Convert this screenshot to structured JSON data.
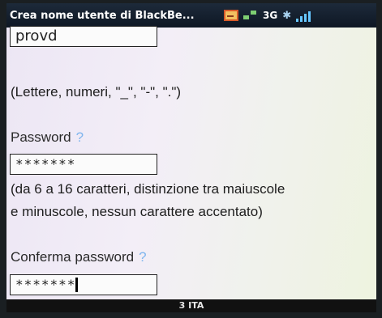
{
  "window": {
    "title": "Crea nome utente di BlackBe..."
  },
  "status_icons": {
    "network": "3G"
  },
  "form": {
    "username_value": "provd",
    "username_hint": "(Lettere, numeri, \"_\", \"-\", \".\")",
    "password_label": "Password",
    "password_help": "?",
    "password_value": "*******",
    "password_hint_line1": "(da 6 a 16 caratteri, distinzione tra maiuscole",
    "password_hint_line2": "e minuscole, nessun carattere accentato)",
    "confirm_label": "Conferma password",
    "confirm_help": "?",
    "confirm_value": "*******"
  },
  "statusbar": {
    "text": "3 ITA"
  }
}
